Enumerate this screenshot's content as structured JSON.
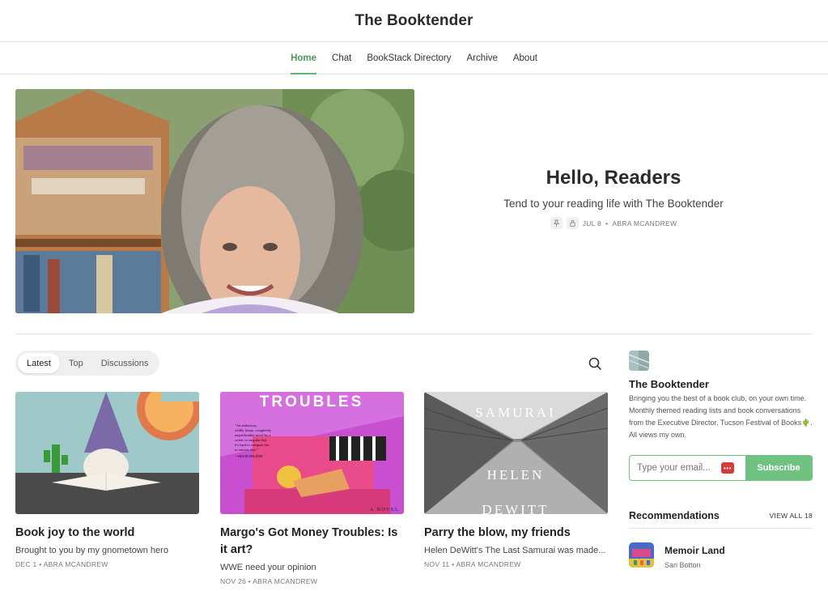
{
  "site": {
    "title": "The Booktender"
  },
  "nav": [
    {
      "label": "Home",
      "active": true
    },
    {
      "label": "Chat"
    },
    {
      "label": "BookStack Directory"
    },
    {
      "label": "Archive"
    },
    {
      "label": "About"
    }
  ],
  "hero": {
    "title": "Hello, Readers",
    "subtitle": "Tend to your reading life with The Booktender",
    "date": "JUL 8",
    "author": "ABRA MCANDREW",
    "icons": [
      "pin-icon",
      "lock-icon"
    ]
  },
  "tabs": [
    {
      "label": "Latest",
      "active": true
    },
    {
      "label": "Top"
    },
    {
      "label": "Discussions"
    }
  ],
  "posts": [
    {
      "title": "Book joy to the world",
      "subtitle": "Brought to you by my gnometown hero",
      "date": "DEC 1",
      "author": "ABRA MCANDREW"
    },
    {
      "title": "Margo's Got Money Troubles: Is it art?",
      "subtitle": "WWE need your opinion",
      "date": "NOV 26",
      "author": "ABRA MCANDREW",
      "cover_text": "TROUBLES",
      "cover_blurb": "\"An audacious, wildly funny, completely unpredictable novel by a writer so singular that it's hard to compare her to anyone else.\"",
      "cover_credit": "—KEVIN WILSON",
      "cover_tag": "A NOVEL"
    },
    {
      "title": "Parry the blow, my friends",
      "subtitle": "Helen DeWitt's The Last Samurai was made...",
      "date": "NOV 11",
      "author": "ABRA MCANDREW",
      "cover_line1": "SAMURAI",
      "cover_line2": "HELEN",
      "cover_line3": "DEWITT"
    }
  ],
  "sidebar": {
    "name": "The Booktender",
    "description": "Bringing you the best of a book club, on your own time. Monthly themed reading lists and book conversations from the Executive Director, Tucson Festival of Books🌵. All views my own.",
    "email_placeholder": "Type your email...",
    "subscribe_label": "Subscribe",
    "recommendations_title": "Recommendations",
    "view_all": "VIEW ALL 18",
    "recommendations": [
      {
        "name": "Memoir Land",
        "author": "Sari Botton"
      }
    ]
  },
  "colors": {
    "accent": "#6fc27f",
    "accent_text": "#4a9a5b"
  }
}
